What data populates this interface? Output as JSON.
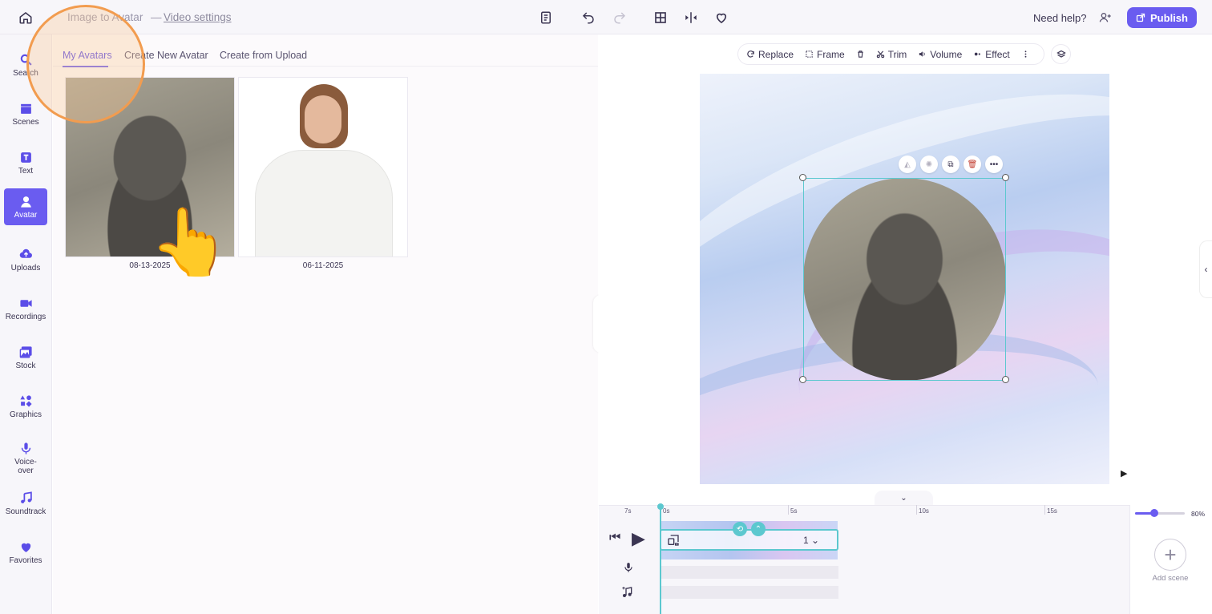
{
  "header": {
    "project_title": "Image to Avatar",
    "title_separator": "—",
    "video_settings": "Video settings",
    "need_help": "Need help?",
    "publish_label": "Publish"
  },
  "nav": {
    "items": [
      {
        "label": "Search"
      },
      {
        "label": "Scenes"
      },
      {
        "label": "Text"
      },
      {
        "label": "Avatar"
      },
      {
        "label": "Uploads"
      },
      {
        "label": "Recordings"
      },
      {
        "label": "Stock"
      },
      {
        "label": "Graphics"
      },
      {
        "label": "Voice-over"
      },
      {
        "label": "Soundtrack"
      },
      {
        "label": "Favorites"
      }
    ],
    "active": "Avatar"
  },
  "panel": {
    "tabs": [
      {
        "label": "My Avatars"
      },
      {
        "label": "Create New Avatar"
      },
      {
        "label": "Create from Upload"
      }
    ],
    "avatars": [
      {
        "date": "08-13-2025"
      },
      {
        "date": "06-11-2025"
      }
    ]
  },
  "toolbar": {
    "replace": "Replace",
    "frame": "Frame",
    "trim": "Trim",
    "volume": "Volume",
    "effect": "Effect"
  },
  "timeline": {
    "ticks": [
      "7s",
      "0s",
      "5s",
      "10s",
      "15s"
    ],
    "scene_number": "1",
    "zoom": "80%",
    "zoom_fraction": 0.38,
    "add_scene": "Add scene"
  },
  "colors": {
    "accent": "#6a5cf0",
    "selection": "#5cc8cf",
    "highlight": "#f29c4f"
  }
}
